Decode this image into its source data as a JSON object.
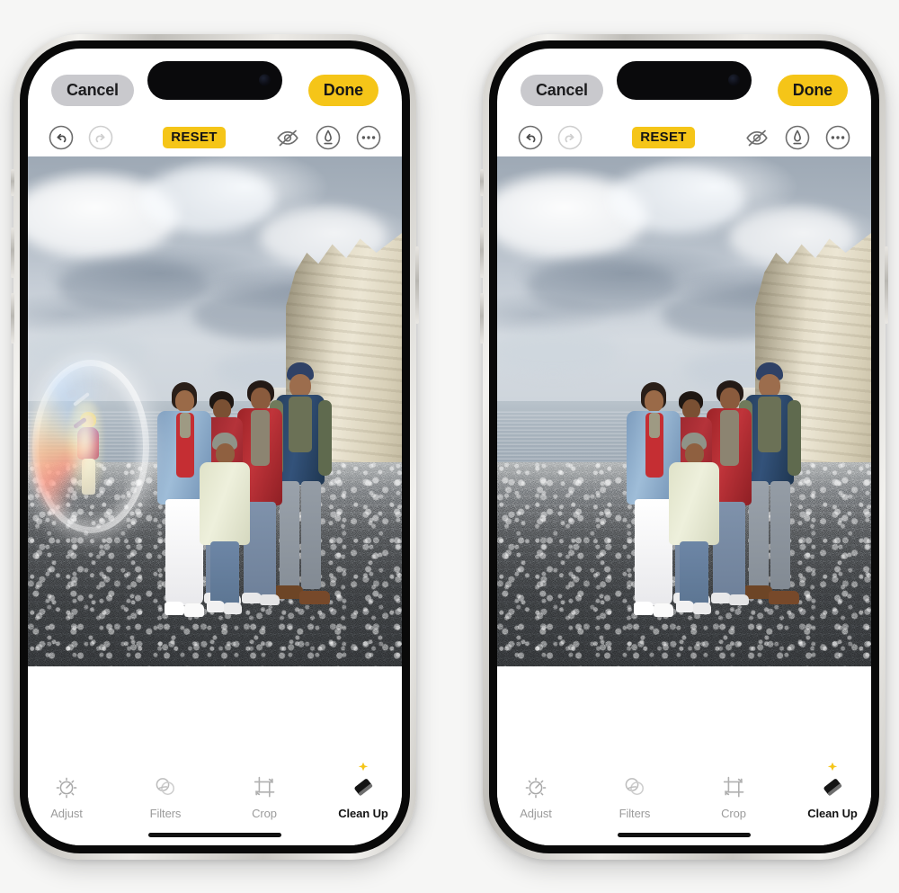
{
  "scene": {
    "description": "Two iPhone screenshots side by side showing the Photos app Clean Up editing tool; left shows a person selected for removal, right shows the photo after removal",
    "background_color": "#f6f6f5"
  },
  "phones": [
    {
      "id": "before",
      "nav": {
        "cancel_label": "Cancel",
        "done_label": "Done"
      },
      "edit_toolbar": {
        "undo_icon": "undo-arrow-icon",
        "undo_enabled": true,
        "redo_icon": "redo-arrow-icon",
        "redo_enabled": false,
        "reset_label": "RESET",
        "markup_visibility_icon": "eye-slash-icon",
        "auto_enhance_icon": "auto-enhance-pen-icon",
        "more_options_icon": "ellipsis-circle-icon"
      },
      "canvas": {
        "photo_caption": "Family of five standing on a pebble beach in front of white chalk cliffs under a cloudy sky",
        "selection_visible": true,
        "selection_label": "clean-up-selection-ring",
        "subject_to_remove": "person taking a selfie near the shoreline"
      },
      "tools": [
        {
          "label": "Adjust",
          "icon": "adjust-dial-icon",
          "active": false
        },
        {
          "label": "Filters",
          "icon": "filters-circles-icon",
          "active": false
        },
        {
          "label": "Crop",
          "icon": "crop-frame-icon",
          "active": false
        },
        {
          "label": "Clean Up",
          "icon": "cleanup-eraser-icon",
          "active": true,
          "badge": "sparkle-icon"
        }
      ]
    },
    {
      "id": "after",
      "nav": {
        "cancel_label": "Cancel",
        "done_label": "Done"
      },
      "edit_toolbar": {
        "undo_icon": "undo-arrow-icon",
        "undo_enabled": true,
        "redo_icon": "redo-arrow-icon",
        "redo_enabled": false,
        "reset_label": "RESET",
        "markup_visibility_icon": "eye-slash-icon",
        "auto_enhance_icon": "auto-enhance-pen-icon",
        "more_options_icon": "ellipsis-circle-icon"
      },
      "canvas": {
        "photo_caption": "Same family photo with the background person removed by Clean Up",
        "selection_visible": false,
        "selection_label": "",
        "subject_to_remove": ""
      },
      "tools": [
        {
          "label": "Adjust",
          "icon": "adjust-dial-icon",
          "active": false
        },
        {
          "label": "Filters",
          "icon": "filters-circles-icon",
          "active": false
        },
        {
          "label": "Crop",
          "icon": "crop-frame-icon",
          "active": false
        },
        {
          "label": "Clean Up",
          "icon": "cleanup-eraser-icon",
          "active": true,
          "badge": "sparkle-icon"
        }
      ]
    }
  ],
  "colors": {
    "accent_yellow": "#f5c518",
    "cancel_gray": "#c9c9cd",
    "label_inactive": "#9b9b9b",
    "label_active": "#141414"
  }
}
